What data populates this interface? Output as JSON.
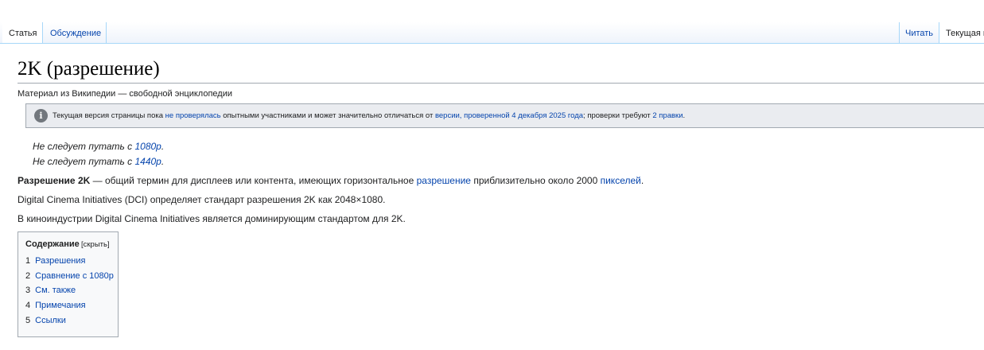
{
  "tabs": {
    "article": "Статья",
    "talk": "Обсуждение",
    "read": "Читать",
    "current": "Текущая в"
  },
  "page": {
    "title": "2K (разрешение)",
    "sitesub": "Материал из Википедии — свободной энциклопедии"
  },
  "notice": {
    "text_1": "Текущая версия страницы пока ",
    "link_unchecked": "не проверялась",
    "text_2": " опытными участниками и может значительно отличаться от ",
    "link_version": "версии, проверенной 4 декабря 2025 года",
    "text_3": "; проверки требуют ",
    "link_edits": "2 правки",
    "text_4": "."
  },
  "hatnotes": [
    {
      "prefix": "Не следует путать с ",
      "link": "1080p",
      "suffix": "."
    },
    {
      "prefix": "Не следует путать с ",
      "link": "1440p",
      "suffix": "."
    }
  ],
  "paragraphs": {
    "p1_bold": "Разрешение 2K",
    "p1_text1": " — общий термин для дисплеев или контента, имеющих горизонтальное ",
    "p1_link1": "разрешение",
    "p1_text2": " приблизительно около 2000 ",
    "p1_link2": "пикселей",
    "p1_text3": ".",
    "p2": "Digital Cinema Initiatives (DCI) определяет стандарт разрешения 2K как 2048×1080.",
    "p3": "В киноиндустрии Digital Cinema Initiatives является доминирующим стандартом для 2K."
  },
  "toc": {
    "title": "Содержание",
    "toggle": "[скрыть]",
    "items": [
      {
        "num": "1",
        "label": "Разрешения"
      },
      {
        "num": "2",
        "label": "Сравнение с 1080p"
      },
      {
        "num": "3",
        "label": "См. также"
      },
      {
        "num": "4",
        "label": "Примечания"
      },
      {
        "num": "5",
        "label": "Ссылки"
      }
    ]
  },
  "colors": {
    "link": "#0645ad",
    "text": "#202122",
    "border": "#a2a9b1",
    "tab_border": "#a7d7f9"
  },
  "icons": {
    "notice": "info-icon"
  }
}
